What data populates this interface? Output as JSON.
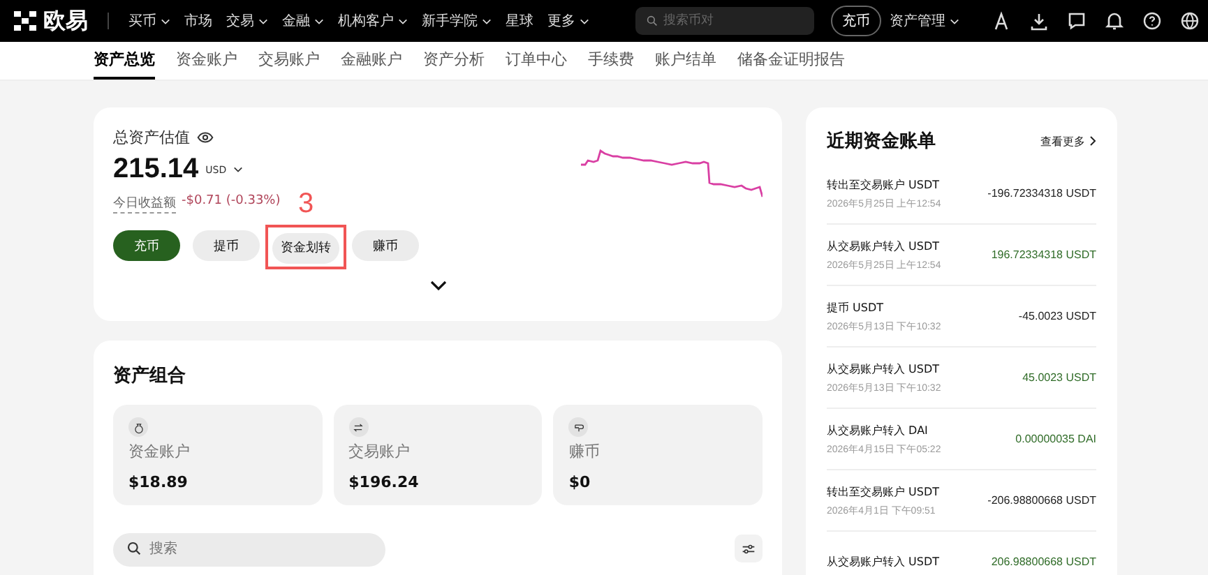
{
  "topbar": {
    "logo": "欧易",
    "menu": [
      {
        "label": "买币",
        "dropdown": true
      },
      {
        "label": "市场",
        "dropdown": false
      },
      {
        "label": "交易",
        "dropdown": true
      },
      {
        "label": "金融",
        "dropdown": true
      },
      {
        "label": "机构客户",
        "dropdown": true
      },
      {
        "label": "新手学院",
        "dropdown": true
      },
      {
        "label": "星球",
        "dropdown": false
      },
      {
        "label": "更多",
        "dropdown": true
      }
    ],
    "search": {
      "placeholder": "搜索币对"
    },
    "deposit": "充币",
    "asset_menu": "资产管理"
  },
  "tabs": [
    {
      "label": "资产总览",
      "selected": true
    },
    {
      "label": "资金账户",
      "selected": false
    },
    {
      "label": "交易账户",
      "selected": false
    },
    {
      "label": "金融账户",
      "selected": false
    },
    {
      "label": "资产分析",
      "selected": false
    },
    {
      "label": "订单中心",
      "selected": false
    },
    {
      "label": "手续费",
      "selected": false
    },
    {
      "label": "账户结单",
      "selected": false
    },
    {
      "label": "储备金证明报告",
      "selected": false
    }
  ],
  "summary": {
    "title": "总资产估值",
    "amount": "215.14",
    "currency": "USD",
    "pnl_label": "今日收益额",
    "pnl": "-$0.71 (-0.33%)",
    "buttons": [
      {
        "label": "充币",
        "kind": "primary"
      },
      {
        "label": "提币",
        "kind": "secondary"
      },
      {
        "label": "资金划转",
        "kind": "secondary",
        "annotation": "3"
      },
      {
        "label": "赚币",
        "kind": "secondary"
      }
    ]
  },
  "portfolio": {
    "title": "资产组合",
    "accounts": [
      {
        "name": "资金账户",
        "value": "$18.89",
        "kind": "funding"
      },
      {
        "name": "交易账户",
        "value": "$196.24",
        "kind": "trading"
      },
      {
        "name": "赚币",
        "value": "$0",
        "kind": "earn"
      }
    ],
    "search": {
      "placeholder": "搜索"
    }
  },
  "ledger": {
    "title": "近期资金账单",
    "more": "查看更多",
    "entries": [
      {
        "title": "转出至交易账户 USDT",
        "time": "2026年5月25日 上午12:54",
        "amount": "-196.72334318 USDT",
        "kind": "out"
      },
      {
        "title": "从交易账户转入 USDT",
        "time": "2026年5月25日 上午12:54",
        "amount": "196.72334318 USDT",
        "kind": "in"
      },
      {
        "title": "提币 USDT",
        "time": "2026年5月13日 下午10:32",
        "amount": "-45.0023 USDT",
        "kind": "out"
      },
      {
        "title": "从交易账户转入 USDT",
        "time": "2026年5月13日 下午10:32",
        "amount": "45.0023 USDT",
        "kind": "in"
      },
      {
        "title": "从交易账户转入 DAI",
        "time": "2026年4月15日 下午05:22",
        "amount": "0.00000035 DAI",
        "kind": "in"
      },
      {
        "title": "转出至交易账户 USDT",
        "time": "2026年4月1日 下午09:51",
        "amount": "-206.98800668 USDT",
        "kind": "out"
      },
      {
        "title": "从交易账户转入 USDT",
        "amount": "206.98800668 USDT",
        "kind": "in"
      }
    ]
  }
}
